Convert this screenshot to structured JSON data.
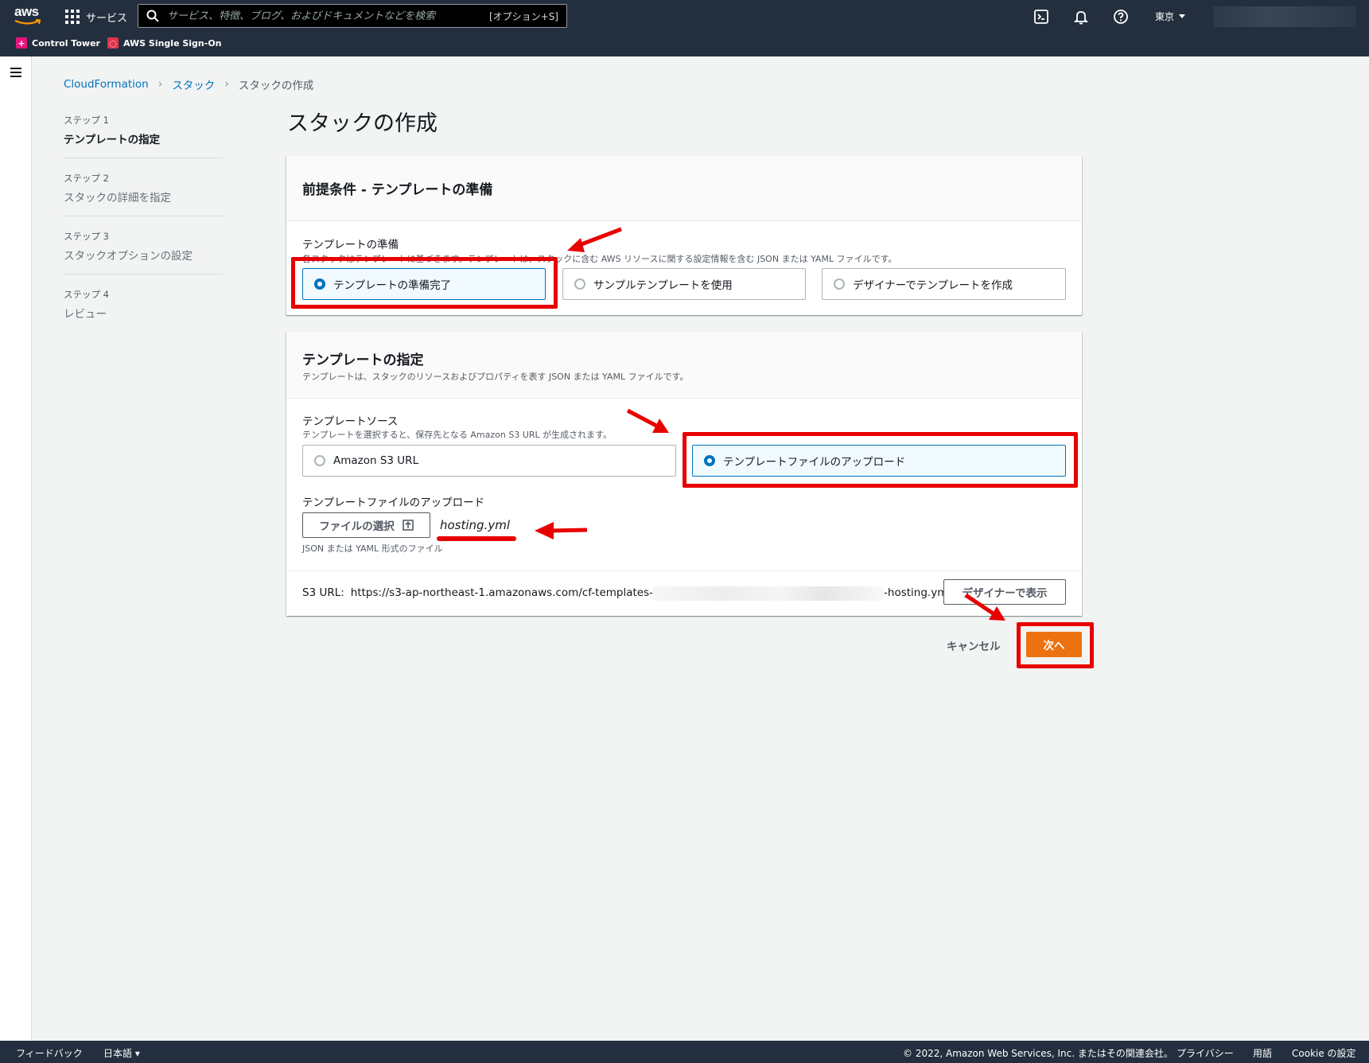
{
  "topbar": {
    "logo_text": "aws",
    "services_label": "サービス",
    "search_placeholder": "サービス、特徴、ブログ、およびドキュメントなどを検索",
    "search_shortcut": "[オプション+S]",
    "region": "東京",
    "favorites": [
      "Control Tower",
      "AWS Single Sign-On"
    ]
  },
  "breadcrumb": [
    "CloudFormation",
    "スタック",
    "スタックの作成"
  ],
  "steps": [
    {
      "num": "ステップ 1",
      "label": "テンプレートの指定"
    },
    {
      "num": "ステップ 2",
      "label": "スタックの詳細を指定"
    },
    {
      "num": "ステップ 3",
      "label": "スタックオプションの設定"
    },
    {
      "num": "ステップ 4",
      "label": "レビュー"
    }
  ],
  "page_title": "スタックの作成",
  "prereq": {
    "title": "前提条件 - テンプレートの準備",
    "field_label": "テンプレートの準備",
    "field_desc": "各スタックはテンプレートに基づきます。テンプレートは、スタックに含む AWS リソースに関する設定情報を含む JSON または YAML ファイルです。",
    "options": [
      "テンプレートの準備完了",
      "サンプルテンプレートを使用",
      "デザイナーでテンプレートを作成"
    ]
  },
  "template": {
    "title": "テンプレートの指定",
    "desc": "テンプレートは、スタックのリソースおよびプロパティを表す JSON または YAML ファイルです。",
    "source_label": "テンプレートソース",
    "source_desc": "テンプレートを選択すると、保存先となる Amazon S3 URL が生成されます。",
    "source_options": [
      "Amazon S3 URL",
      "テンプレートファイルのアップロード"
    ],
    "upload_label": "テンプレートファイルのアップロード",
    "choose_file_label": "ファイルの選択",
    "file_name": "hosting.yml",
    "file_hint": "JSON または YAML 形式のファイル",
    "s3_label": "S3 URL:",
    "s3_url_prefix": "https://s3-ap-northeast-1.amazonaws.com/cf-templates-",
    "s3_url_suffix": "-hosting.yml",
    "designer_button": "デザイナーで表示"
  },
  "actions": {
    "cancel": "キャンセル",
    "next": "次へ"
  },
  "footer": {
    "feedback": "フィードバック",
    "language": "日本語",
    "copyright": "© 2022, Amazon Web Services, Inc. またはその関連会社。",
    "privacy": "プライバシー",
    "terms": "用語",
    "cookie": "Cookie の設定"
  },
  "colors": {
    "accent": "#0073bb",
    "primary_button": "#ec7211",
    "annotation": "#e80000",
    "nav": "#232f3e"
  }
}
